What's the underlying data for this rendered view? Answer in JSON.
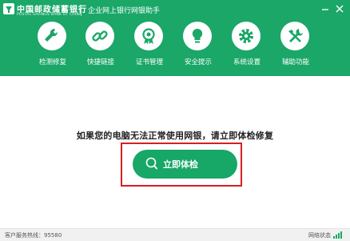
{
  "header": {
    "bank_name": "中国邮政储蓄银行",
    "bank_name_en": "POSTAL SAVINGS BANK OF CHINA",
    "app_title": "企业网上银行网银助手",
    "brand_color": "#1aa768"
  },
  "window_controls": {
    "minimize_icon": "minimize-icon",
    "close_icon": "close-icon"
  },
  "nav": [
    {
      "label": "检测修复",
      "icon": "wrench-icon"
    },
    {
      "label": "快捷链接",
      "icon": "link-icon"
    },
    {
      "label": "证书管理",
      "icon": "certificate-icon"
    },
    {
      "label": "安全提示",
      "icon": "bulb-icon"
    },
    {
      "label": "系统设置",
      "icon": "gear-icon"
    },
    {
      "label": "辅助功能",
      "icon": "tools-icon"
    }
  ],
  "main": {
    "message": "如果您的电脑无法正常使用网银，请立即体检修复",
    "check_button": "立即体检",
    "highlight_color": "#d61f1f"
  },
  "status": {
    "hotline": "客户服务热线：95580",
    "network": "网络状态"
  }
}
